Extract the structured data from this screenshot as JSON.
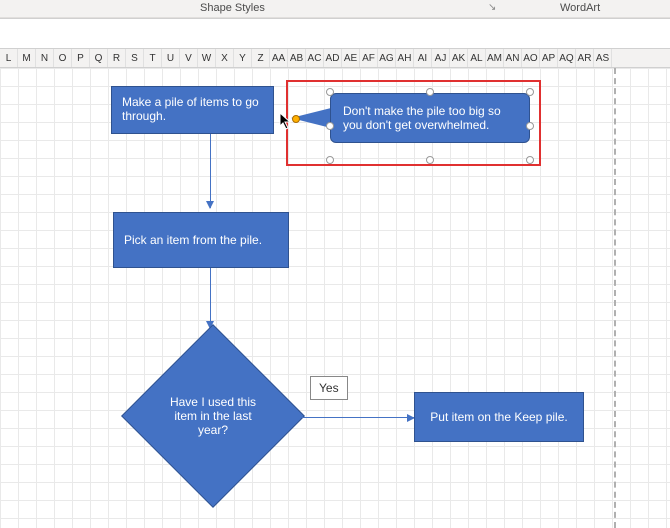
{
  "ribbon": {
    "group1": "Shape Styles",
    "group2": "WordArt",
    "dialog_launcher": "↘"
  },
  "columns": [
    "L",
    "M",
    "N",
    "O",
    "P",
    "Q",
    "R",
    "S",
    "T",
    "U",
    "V",
    "W",
    "X",
    "Y",
    "Z",
    "AA",
    "AB",
    "AC",
    "AD",
    "AE",
    "AF",
    "AG",
    "AH",
    "AI",
    "AJ",
    "AK",
    "AL",
    "AM",
    "AN",
    "AO",
    "AP",
    "AQ",
    "AR",
    "AS"
  ],
  "flow": {
    "step1": "Make a pile of items to go through.",
    "callout": "Don't make the pile too big so you don't get overwhelmed.",
    "step2": "Pick an item from the pile.",
    "decision": "Have I used this item in the last year?",
    "yes_label": "Yes",
    "step3": "Put item on the Keep pile."
  }
}
